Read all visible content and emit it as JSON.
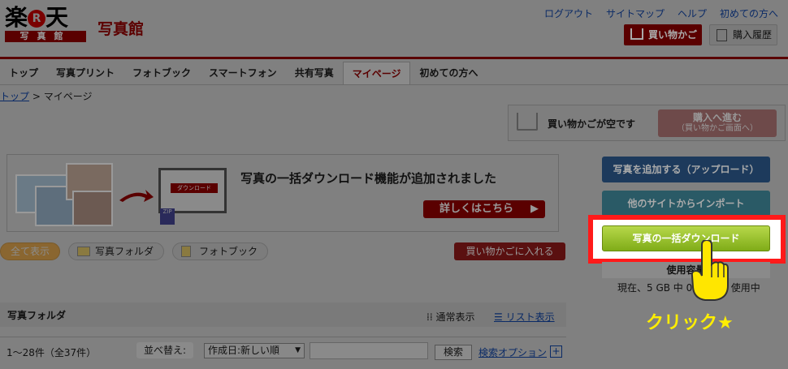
{
  "logo": {
    "main": "楽天",
    "r": "R",
    "sub": "写真館"
  },
  "site_name": "写真館",
  "top_links": [
    "ログアウト",
    "サイトマップ",
    "ヘルプ",
    "初めての方へ"
  ],
  "header_buttons": {
    "cart": "買い物かご",
    "history": "購入履歴"
  },
  "nav_tabs": [
    "トップ",
    "写真プリント",
    "フォトブック",
    "スマートフォン",
    "共有写真",
    "マイページ",
    "初めての方へ"
  ],
  "nav_active_index": 5,
  "breadcrumb": {
    "home": "トップ",
    "sep": ">",
    "current": "マイページ"
  },
  "cart_box": {
    "message": "買い物かごが空です",
    "proceed": "購入へ進む",
    "proceed_sub": "（買い物かご画面へ）"
  },
  "banner": {
    "title": "写真の一括ダウンロード機能が追加されました",
    "more": "詳しくはこちら",
    "screen_button": "ダウンロード",
    "zip": "ZIP"
  },
  "filters": [
    "全て表示",
    "写真フォルダ",
    "フォトブック"
  ],
  "add_to_cart": "買い物かごに入れる",
  "side_buttons": {
    "upload": "写真を追加する（アップロード）",
    "import": "他のサイトからインポート",
    "bulk_download": "写真の一括ダウンロード"
  },
  "usage": {
    "title": "使用容量",
    "text": "現在、5 GB 中 0.1",
    "text_end": "使用中"
  },
  "annotation": "クリック★",
  "folder_list": {
    "title": "写真フォルダ",
    "view_normal": "通常表示",
    "view_list": "リスト表示"
  },
  "list_controls": {
    "count": "1〜28件（全37件）",
    "sort_label": "並べ替え:",
    "sort_value": "作成日:新しい順",
    "search_button": "検索",
    "search_option": "検索オプション",
    "plus": "+"
  },
  "colors": {
    "highlight": "#ff1a1a",
    "annotation": "#ffee00",
    "accent": "#5a0000"
  }
}
